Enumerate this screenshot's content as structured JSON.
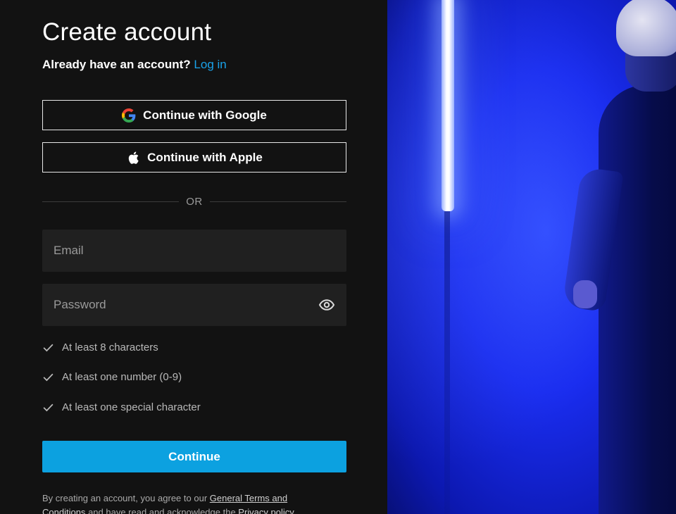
{
  "page": {
    "title": "Create account",
    "already_text": "Already have an account?",
    "login_link": "Log in"
  },
  "social": {
    "google_label": "Continue with Google",
    "apple_label": "Continue with Apple"
  },
  "divider": {
    "text": "OR"
  },
  "form": {
    "email_placeholder": "Email",
    "password_placeholder": "Password"
  },
  "requirements": [
    {
      "text": "At least 8 characters"
    },
    {
      "text": "At least one number (0-9)"
    },
    {
      "text": "At least one special character"
    }
  ],
  "actions": {
    "continue_label": "Continue"
  },
  "terms": {
    "prefix": "By creating an account, you agree to our",
    "link1": "General Terms and Conditions",
    "middle": "and have read and acknowledge the",
    "link2": "Privacy policy"
  },
  "colors": {
    "background": "#121212",
    "accent": "#0ca1e0",
    "link": "#1aa3ea",
    "field_bg": "#202020"
  },
  "icons": {
    "google": "google-logo-icon",
    "apple": "apple-logo-icon",
    "eye": "eye-icon",
    "check": "check-icon"
  }
}
